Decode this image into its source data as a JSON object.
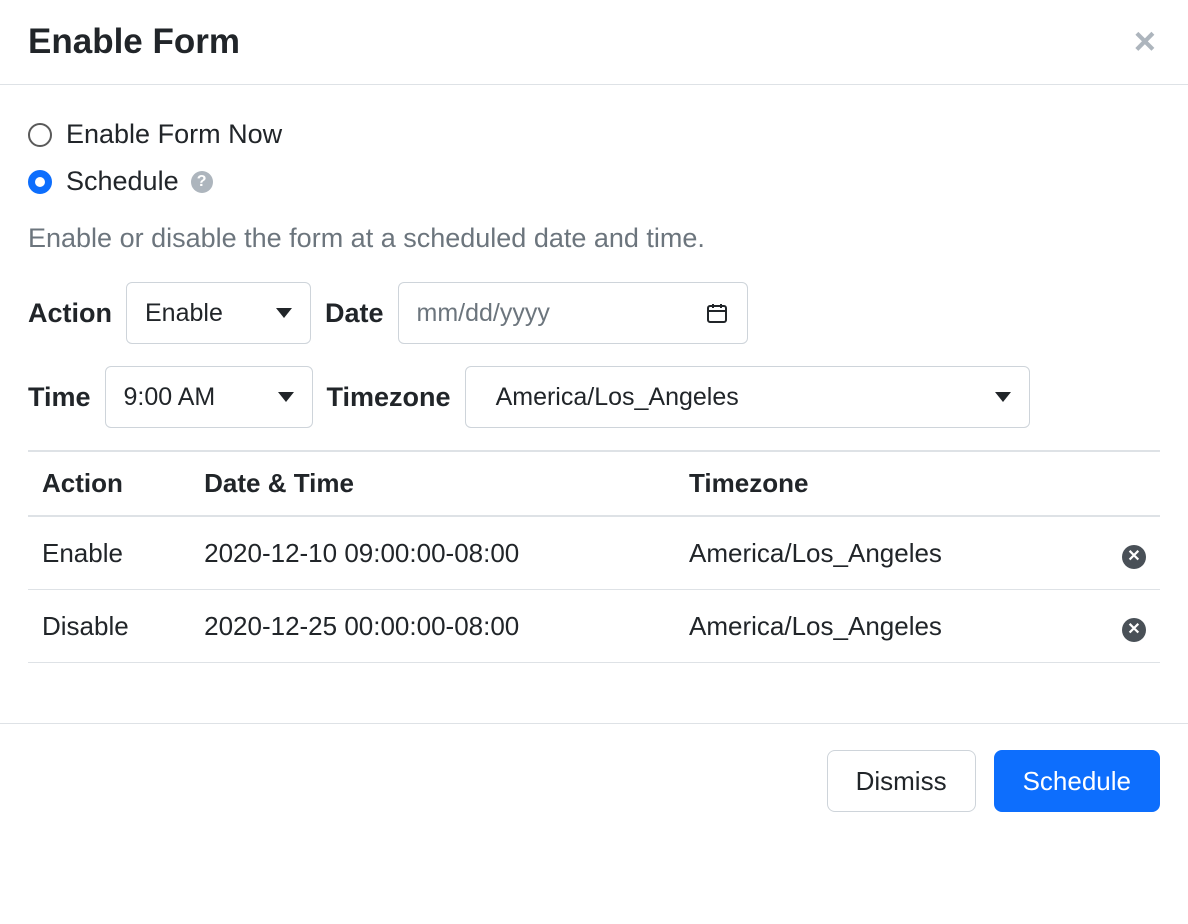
{
  "header": {
    "title": "Enable Form"
  },
  "options": {
    "enable_now_label": "Enable Form Now",
    "schedule_label": "Schedule"
  },
  "description": "Enable or disable the form at a scheduled date and time.",
  "form": {
    "action_label": "Action",
    "action_value": "Enable",
    "date_label": "Date",
    "date_placeholder": "mm/dd/yyyy",
    "time_label": "Time",
    "time_value": "9:00 AM",
    "timezone_label": "Timezone",
    "timezone_value": "America/Los_Angeles"
  },
  "table": {
    "headers": {
      "action": "Action",
      "datetime": "Date & Time",
      "timezone": "Timezone"
    },
    "rows": [
      {
        "action": "Enable",
        "datetime": "2020-12-10 09:00:00-08:00",
        "timezone": "America/Los_Angeles"
      },
      {
        "action": "Disable",
        "datetime": "2020-12-25 00:00:00-08:00",
        "timezone": "America/Los_Angeles"
      }
    ]
  },
  "footer": {
    "dismiss_label": "Dismiss",
    "schedule_label": "Schedule"
  }
}
